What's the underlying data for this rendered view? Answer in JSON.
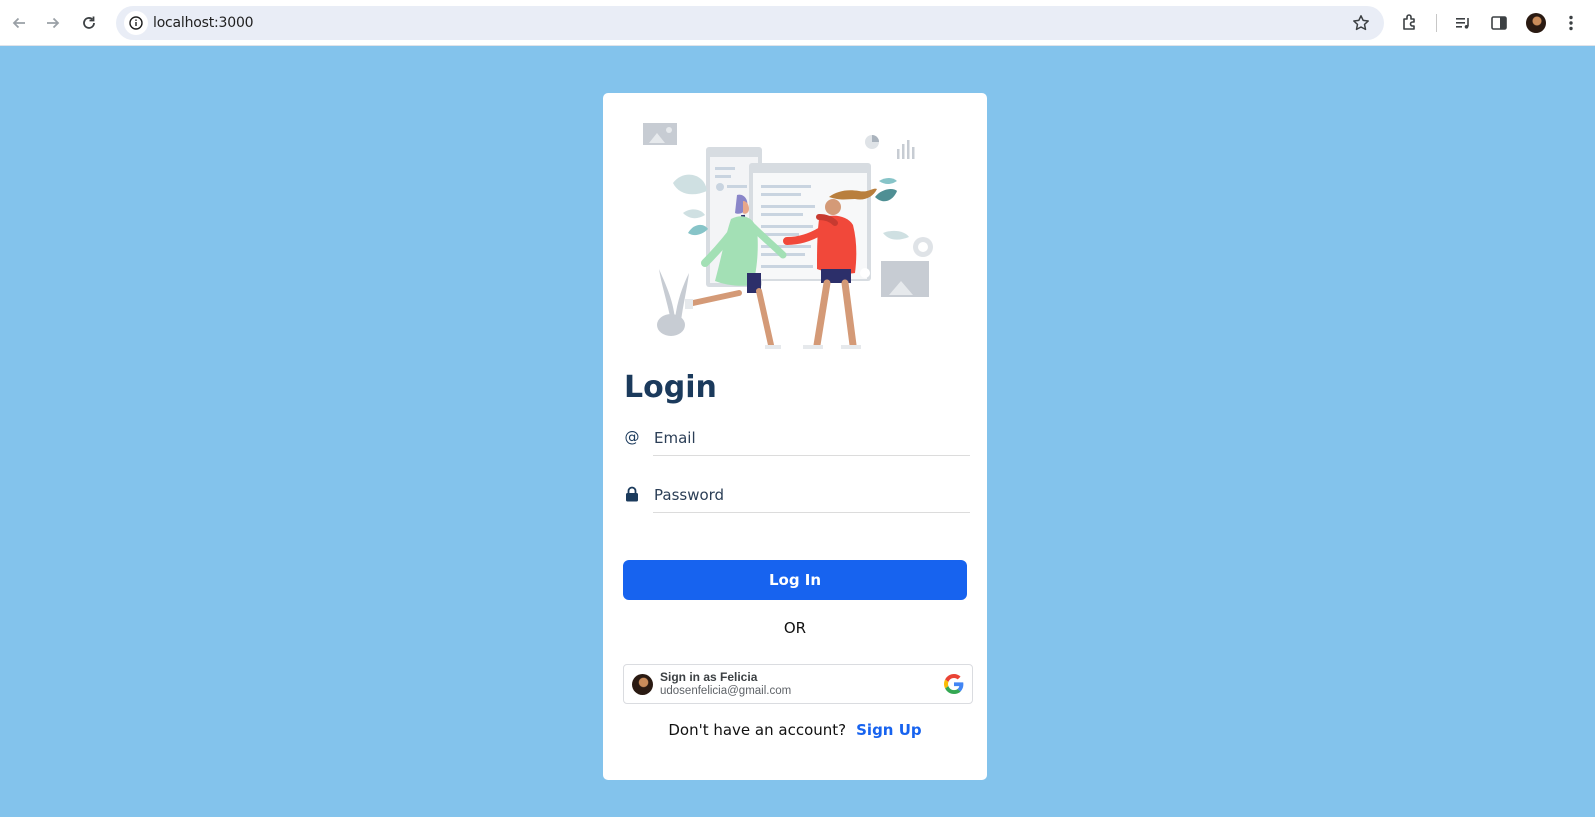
{
  "browser": {
    "url": "localhost:3000",
    "back_icon": "arrow-left-icon",
    "forward_icon": "arrow-right-icon",
    "reload_icon": "reload-icon"
  },
  "login": {
    "title": "Login",
    "email_placeholder": "Email",
    "password_placeholder": "Password",
    "email_icon_glyph": "@",
    "submit_label": "Log In",
    "or_label": "OR",
    "google": {
      "name_label": "Sign in as Felicia",
      "email": "udosenfelicia@gmail.com"
    },
    "signup_prompt": "Don't have an account?",
    "signup_link": "Sign Up"
  },
  "colors": {
    "page_background": "#83c3ec",
    "primary": "#1763ef",
    "title": "#1b3a5c"
  }
}
